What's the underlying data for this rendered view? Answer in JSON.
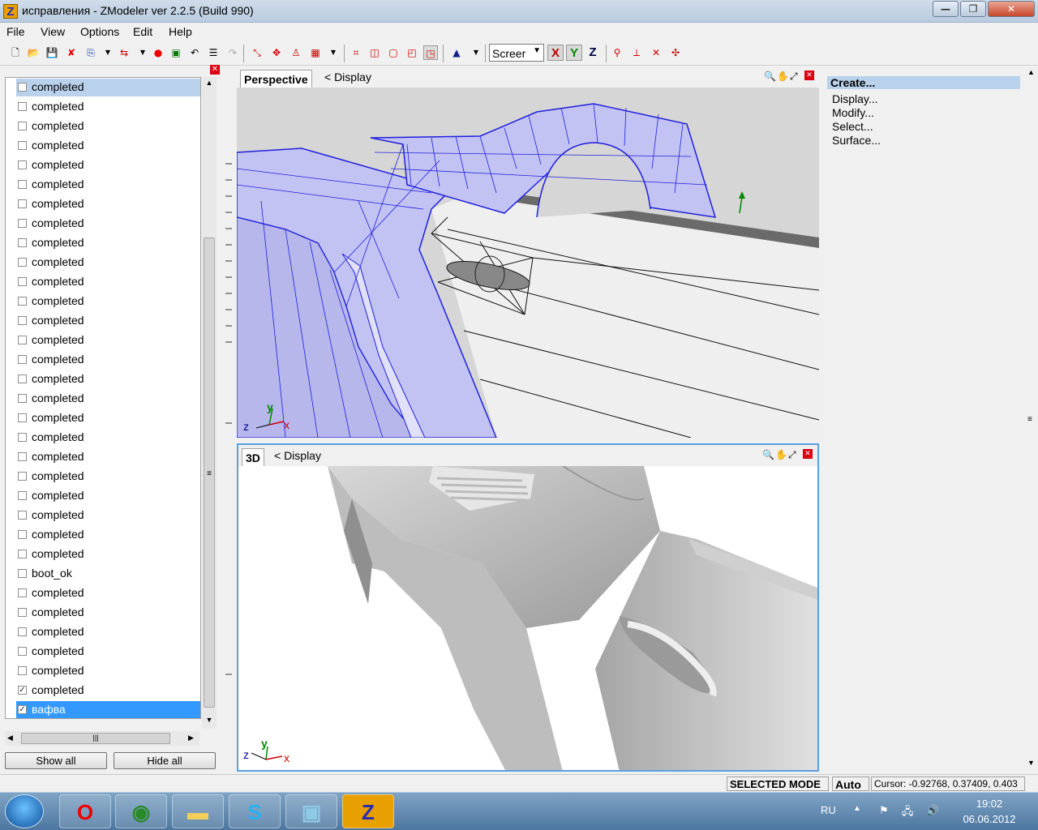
{
  "window": {
    "title": "исправления - ZModeler ver 2.2.5 (Build 990)",
    "icon_letter": "Z"
  },
  "menu": [
    "File",
    "View",
    "Options",
    "Edit",
    "Help"
  ],
  "toolbar": {
    "screen_mode": "Screer",
    "axes": [
      "X",
      "Y",
      "Z"
    ]
  },
  "object_list": {
    "items": [
      {
        "label": "completed",
        "checked": false
      },
      {
        "label": "completed",
        "checked": false
      },
      {
        "label": "completed",
        "checked": false
      },
      {
        "label": "completed",
        "checked": false
      },
      {
        "label": "completed",
        "checked": false
      },
      {
        "label": "completed",
        "checked": false
      },
      {
        "label": "completed",
        "checked": false
      },
      {
        "label": "completed",
        "checked": false
      },
      {
        "label": "completed",
        "checked": false
      },
      {
        "label": "completed",
        "checked": false
      },
      {
        "label": "completed",
        "checked": false
      },
      {
        "label": "completed",
        "checked": false
      },
      {
        "label": "completed",
        "checked": false
      },
      {
        "label": "completed",
        "checked": false
      },
      {
        "label": "completed",
        "checked": false
      },
      {
        "label": "completed",
        "checked": false
      },
      {
        "label": "completed",
        "checked": false
      },
      {
        "label": "completed",
        "checked": false
      },
      {
        "label": "completed",
        "checked": false
      },
      {
        "label": "completed",
        "checked": false
      },
      {
        "label": "completed",
        "checked": false
      },
      {
        "label": "completed",
        "checked": false
      },
      {
        "label": "completed",
        "checked": false
      },
      {
        "label": "completed",
        "checked": false
      },
      {
        "label": "completed",
        "checked": false
      },
      {
        "label": "boot_ok",
        "checked": false
      },
      {
        "label": "completed",
        "checked": false
      },
      {
        "label": "completed",
        "checked": false
      },
      {
        "label": "completed",
        "checked": false
      },
      {
        "label": "completed",
        "checked": false
      },
      {
        "label": "completed",
        "checked": false
      },
      {
        "label": "completed",
        "checked": true
      },
      {
        "label": "вафва",
        "checked": true
      }
    ],
    "show_all": "Show all",
    "hide_all": "Hide all"
  },
  "viewport_top": {
    "tab": "Perspective",
    "menu": "<  Display"
  },
  "viewport_bottom": {
    "tab": "3D",
    "menu": "<  Display"
  },
  "axis_labels": {
    "x": "x",
    "y": "y",
    "z": "z"
  },
  "command_panel": {
    "items": [
      "Create...",
      "Display...",
      "Modify...",
      "Select...",
      "Surface..."
    ]
  },
  "status": {
    "mode": "SELECTED MODE",
    "auto": "Auto",
    "cursor": "Cursor: -0.92768, 0.37409, 0.403"
  },
  "taskbar": {
    "lang": "RU",
    "time": "19:02",
    "date": "06.06.2012"
  },
  "colors": {
    "wire": "#1f1fdc",
    "selection": "#3399ff",
    "mesh_fill": "#c3c3f3"
  }
}
